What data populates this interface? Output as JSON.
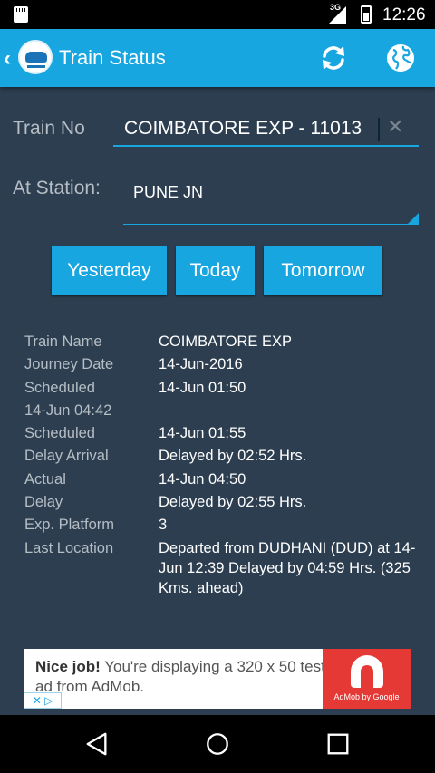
{
  "status_bar": {
    "network_label": "3G",
    "time": "12:26"
  },
  "app_bar": {
    "title": "Train Status",
    "icons": [
      "back-arrow",
      "train-logo",
      "refresh",
      "globe"
    ]
  },
  "form": {
    "train_label": "Train No",
    "train_value": "COIMBATORE EXP - 11013",
    "station_label": "At Station:",
    "station_value": "PUNE JN"
  },
  "day_buttons": {
    "yesterday": "Yesterday",
    "today": "Today",
    "tomorrow": "Tomorrow"
  },
  "details": [
    {
      "key": "Train Name",
      "value": "COIMBATORE EXP"
    },
    {
      "key": "Journey Date",
      "value": "14-Jun-2016"
    },
    {
      "key": "Scheduled",
      "value": "14-Jun 01:50"
    },
    {
      "key": "14-Jun 04:42",
      "value": ""
    },
    {
      "key": "Scheduled",
      "value": "14-Jun 01:55"
    },
    {
      "key": "Delay Arrival",
      "value": "Delayed by 02:52 Hrs."
    },
    {
      "key": "Actual",
      "value": "14-Jun 04:50"
    },
    {
      "key": "Delay",
      "value": "Delayed by 02:55 Hrs."
    },
    {
      "key": "Exp. Platform",
      "value": "3"
    },
    {
      "key": "Last Location",
      "value": "Departed from DUDHANI (DUD) at 14-Jun 12:39 Delayed by 04:59 Hrs. (325 Kms. ahead)"
    }
  ],
  "ad": {
    "headline": "Nice job!",
    "body": " You're displaying a 320 x 50 test ad from AdMob.",
    "brand": "AdMob by Google"
  },
  "colors": {
    "accent": "#17a6e0",
    "background": "#2c3e50",
    "label": "#b6bdc4",
    "ad_brand": "#e53935"
  }
}
